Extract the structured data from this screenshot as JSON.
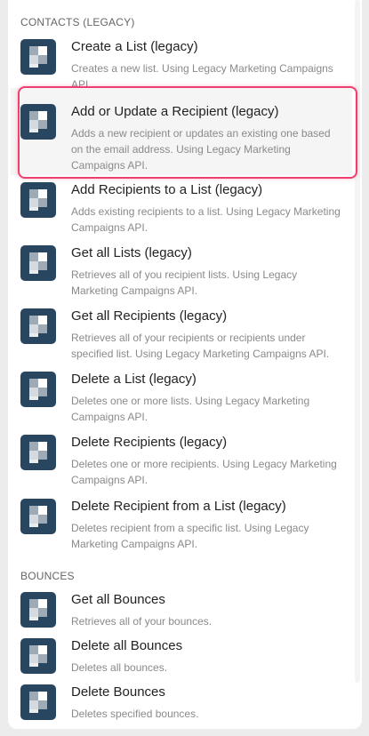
{
  "sections": [
    {
      "header": "CONTACTS (LEGACY)",
      "items": [
        {
          "title": "Create a List (legacy)",
          "desc": "Creates a new list. Using Legacy Marketing Campaigns API."
        },
        {
          "title": "Add or Update a Recipient (legacy)",
          "desc": "Adds a new recipient or updates an existing one based on the email address. Using Legacy Marketing Campaigns API.",
          "highlighted": true
        },
        {
          "title": "Add Recipients to a List (legacy)",
          "desc": "Adds existing recipients to a list. Using Legacy Marketing Campaigns API."
        },
        {
          "title": "Get all Lists (legacy)",
          "desc": "Retrieves all of you recipient lists. Using Legacy Marketing Campaigns API."
        },
        {
          "title": "Get all Recipients (legacy)",
          "desc": "Retrieves all of your recipients or recipients under specified list. Using Legacy Marketing Campaigns API."
        },
        {
          "title": "Delete a List (legacy)",
          "desc": "Deletes one or more lists. Using Legacy Marketing Campaigns API."
        },
        {
          "title": "Delete Recipients (legacy)",
          "desc": "Deletes one or more recipients. Using Legacy Marketing Campaigns API."
        },
        {
          "title": "Delete Recipient from a List (legacy)",
          "desc": "Deletes recipient from a specific list. Using Legacy Marketing Campaigns API."
        }
      ]
    },
    {
      "header": "BOUNCES",
      "items": [
        {
          "title": "Get all Bounces",
          "desc": "Retrieves all of your bounces."
        },
        {
          "title": "Delete all Bounces",
          "desc": "Deletes all bounces."
        },
        {
          "title": "Delete Bounces",
          "desc": "Deletes specified bounces."
        }
      ]
    }
  ],
  "icon": "sendgrid-logo-icon",
  "colors": {
    "icon_bg": "#294661",
    "highlight": "#ee3f6e"
  }
}
